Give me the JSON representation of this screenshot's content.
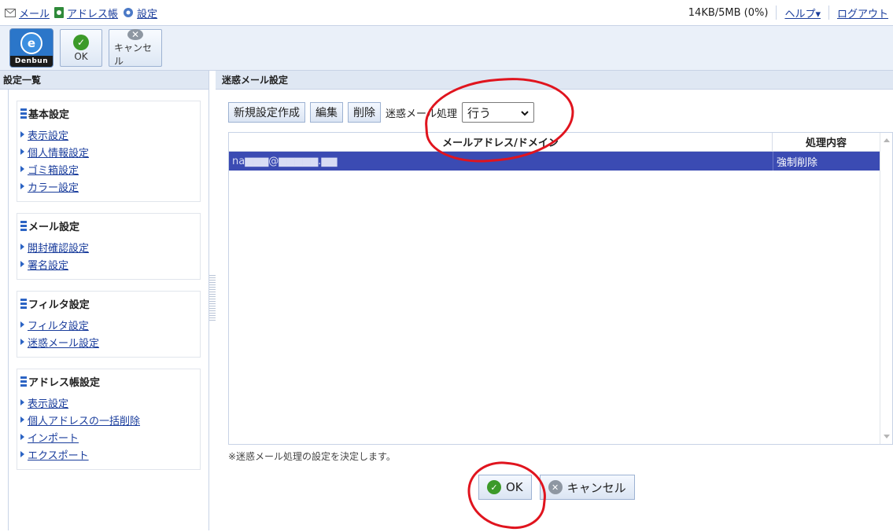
{
  "topnav": {
    "mail": "メール",
    "addressbook": "アドレス帳",
    "settings": "設定"
  },
  "topright": {
    "quota": "14KB/5MB (0%)",
    "help": "ヘルプ▾",
    "logout": "ログアウト"
  },
  "toolbar": {
    "logo_letter": "e",
    "logo_text": "Denbun",
    "ok": "OK",
    "cancel": "キャンセル"
  },
  "left": {
    "title": "設定一覧",
    "groups": [
      {
        "title": "基本設定",
        "items": [
          "表示設定",
          "個人情報設定",
          "ゴミ箱設定",
          "カラー設定"
        ]
      },
      {
        "title": "メール設定",
        "items": [
          "開封確認設定",
          "署名設定"
        ]
      },
      {
        "title": "フィルタ設定",
        "items": [
          "フィルタ設定",
          "迷惑メール設定"
        ]
      },
      {
        "title": "アドレス帳設定",
        "items": [
          "表示設定",
          "個人アドレスの一括削除",
          "インポート",
          "エクスポート"
        ]
      }
    ]
  },
  "right": {
    "title": "迷惑メール設定",
    "buttons": {
      "new": "新規設定作成",
      "edit": "編集",
      "delete": "削除"
    },
    "processing_label": "迷惑メール処理",
    "processing_value": "行う",
    "columns": [
      "メールアドレス/ドメイン",
      "処理内容"
    ],
    "rows": [
      {
        "address": "na▆▆▆@▆▆▆▆▆.▆▆",
        "action": "強制削除"
      }
    ],
    "note": "※迷惑メール処理の設定を決定します。",
    "ok": "OK",
    "cancel": "キャンセル"
  },
  "colors": {
    "selected_row": "#3b4bb3",
    "annotation": "#e0141e",
    "link": "#1a3d9c"
  }
}
